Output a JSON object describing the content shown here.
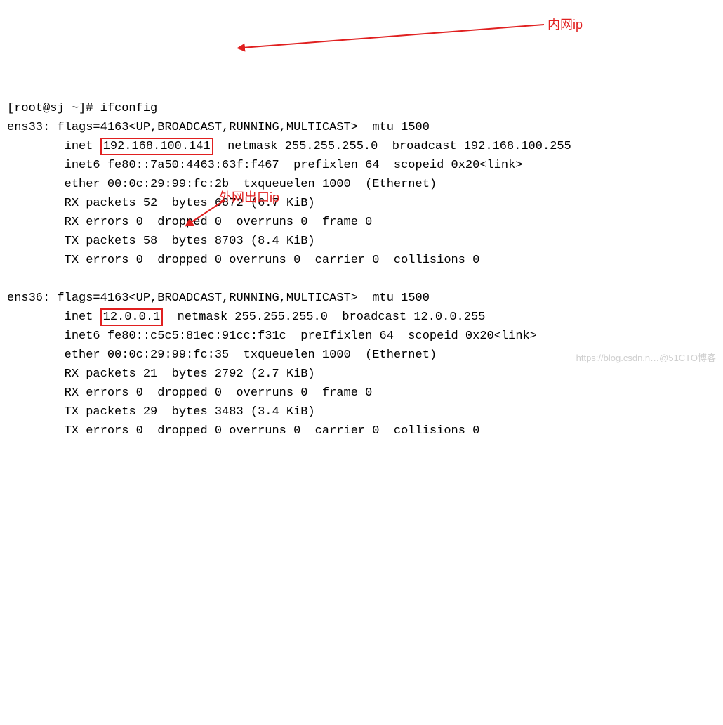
{
  "prompt": "[root@sj ~]# ",
  "cmd": "ifconfig",
  "ens33": {
    "name": "ens33",
    "flags_pre": "flags=4163<UP,BROADCAST,RUNNING,MULTICAST>",
    "mtu_label": "mtu 1500",
    "inet": "192.168.100.141",
    "netmask": "netmask 255.255.255.0",
    "bcast": "broadcast 192.168.100.255",
    "inet6": "inet6 fe80::7a50:4463:63f:f467  prefixlen 64  scopeid 0x20<link>",
    "ether": "ether 00:0c:29:99:fc:2b  txqueuelen 1000  (Ethernet)",
    "rx": "RX packets 52  bytes 6872 (6.7 KiB)",
    "rxerr": "RX errors 0  dropped 0  overruns 0  frame 0",
    "tx": "TX packets 58  bytes 8703 (8.4 KiB)",
    "txerr": "TX errors 0  dropped 0 overruns 0  carrier 0  collisions 0"
  },
  "ens36": {
    "name": "ens36",
    "flags_pre": "flags=4163<UP,BROADCAST,RUNNING,MULTICAST>",
    "mtu_label": "mtu 1500",
    "inet": "12.0.0.1",
    "netmask": "netmask 255.255.255.0",
    "cursor": "I",
    "bcast": "broadcast 12.0.0.255",
    "inet6_a": "inet6 fe80::c5c5:81ec:91cc:f31c  pre",
    "inet6_b": "fixlen 64  scopeid 0x20<link>",
    "ether": "ether 00:0c:29:99:fc:35  txqueuelen 1000  (Ethernet)",
    "rx": "RX packets 21  bytes 2792 (2.7 KiB)",
    "rxerr": "RX errors 0  dropped 0  overruns 0  frame 0",
    "tx": "TX packets 29  bytes 3483 (3.4 KiB)",
    "txerr": "TX errors 0  dropped 0 overruns 0  carrier 0  collisions 0"
  },
  "notes": {
    "inner": "内网ip",
    "outer": "外网出口ip"
  },
  "watermark": "https://blog.csdn.n…@51CTO博客"
}
